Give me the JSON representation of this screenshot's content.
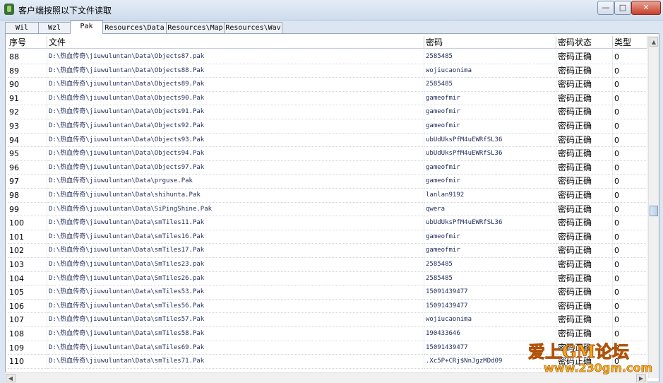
{
  "window": {
    "title": "客户端按照以下文件读取",
    "min": "—",
    "max": "□",
    "close": "✕"
  },
  "tabs": [
    "Wil",
    "Wzl",
    "Pak",
    "Resources\\Data",
    "Resources\\Map",
    "Resources\\Wav"
  ],
  "active_tab": "Pak",
  "columns": [
    "序号",
    "文件",
    "密码",
    "密码状态",
    "类型"
  ],
  "rows": [
    {
      "idx": "88",
      "file": "D:\\热血传奇\\jiuwuluntan\\Data\\Objects87.pak",
      "pwd": "2585485",
      "status": "密码正确",
      "type": "0"
    },
    {
      "idx": "89",
      "file": "D:\\热血传奇\\jiuwuluntan\\Data\\Objects88.Pak",
      "pwd": "wojiucaonima",
      "status": "密码正确",
      "type": "0"
    },
    {
      "idx": "90",
      "file": "D:\\热血传奇\\jiuwuluntan\\Data\\Objects89.Pak",
      "pwd": "2585485",
      "status": "密码正确",
      "type": "0"
    },
    {
      "idx": "91",
      "file": "D:\\热血传奇\\jiuwuluntan\\Data\\Objects90.Pak",
      "pwd": "gameofmir",
      "status": "密码正确",
      "type": "0"
    },
    {
      "idx": "92",
      "file": "D:\\热血传奇\\jiuwuluntan\\Data\\Objects91.Pak",
      "pwd": "gameofmir",
      "status": "密码正确",
      "type": "0"
    },
    {
      "idx": "93",
      "file": "D:\\热血传奇\\jiuwuluntan\\Data\\Objects92.Pak",
      "pwd": "gameofmir",
      "status": "密码正确",
      "type": "0"
    },
    {
      "idx": "94",
      "file": "D:\\热血传奇\\jiuwuluntan\\Data\\Objects93.Pak",
      "pwd": "ubUdUksPfM4uEWRfSL36",
      "status": "密码正确",
      "type": "0"
    },
    {
      "idx": "95",
      "file": "D:\\热血传奇\\jiuwuluntan\\Data\\Objects94.Pak",
      "pwd": "ubUdUksPfM4uEWRfSL36",
      "status": "密码正确",
      "type": "0"
    },
    {
      "idx": "96",
      "file": "D:\\热血传奇\\jiuwuluntan\\Data\\Objects97.Pak",
      "pwd": "gameofmir",
      "status": "密码正确",
      "type": "0"
    },
    {
      "idx": "97",
      "file": "D:\\热血传奇\\jiuwuluntan\\Data\\prguse.Pak",
      "pwd": "gameofmir",
      "status": "密码正确",
      "type": "0"
    },
    {
      "idx": "98",
      "file": "D:\\热血传奇\\jiuwuluntan\\Data\\shihunta.Pak",
      "pwd": "lanlan9192",
      "status": "密码正确",
      "type": "0"
    },
    {
      "idx": "99",
      "file": "D:\\热血传奇\\jiuwuluntan\\Data\\SiPingShine.Pak",
      "pwd": "qwera",
      "status": "密码正确",
      "type": "0"
    },
    {
      "idx": "100",
      "file": "D:\\热血传奇\\jiuwuluntan\\Data\\smTiles11.Pak",
      "pwd": "ubUdUksPfM4uEWRfSL36",
      "status": "密码正确",
      "type": "0"
    },
    {
      "idx": "101",
      "file": "D:\\热血传奇\\jiuwuluntan\\Data\\smTiles16.Pak",
      "pwd": "gameofmir",
      "status": "密码正确",
      "type": "0"
    },
    {
      "idx": "102",
      "file": "D:\\热血传奇\\jiuwuluntan\\Data\\smTiles17.Pak",
      "pwd": "gameofmir",
      "status": "密码正确",
      "type": "0"
    },
    {
      "idx": "103",
      "file": "D:\\热血传奇\\jiuwuluntan\\Data\\SmTiles23.pak",
      "pwd": "2585485",
      "status": "密码正确",
      "type": "0"
    },
    {
      "idx": "104",
      "file": "D:\\热血传奇\\jiuwuluntan\\Data\\SmTiles26.pak",
      "pwd": "2585485",
      "status": "密码正确",
      "type": "0"
    },
    {
      "idx": "105",
      "file": "D:\\热血传奇\\jiuwuluntan\\Data\\smTiles53.Pak",
      "pwd": "15091439477",
      "status": "密码正确",
      "type": "0"
    },
    {
      "idx": "106",
      "file": "D:\\热血传奇\\jiuwuluntan\\Data\\smTiles56.Pak",
      "pwd": "15091439477",
      "status": "密码正确",
      "type": "0"
    },
    {
      "idx": "107",
      "file": "D:\\热血传奇\\jiuwuluntan\\Data\\smTiles57.Pak",
      "pwd": "wojiucaonima",
      "status": "密码正确",
      "type": "0"
    },
    {
      "idx": "108",
      "file": "D:\\热血传奇\\jiuwuluntan\\Data\\smTiles58.Pak",
      "pwd": "190433646",
      "status": "密码正确",
      "type": "0"
    },
    {
      "idx": "109",
      "file": "D:\\热血传奇\\jiuwuluntan\\Data\\smTiles69.Pak",
      "pwd": "15091439477",
      "status": "密码正确",
      "type": "0"
    },
    {
      "idx": "110",
      "file": "D:\\热血传奇\\jiuwuluntan\\Data\\smTiles71.Pak",
      "pwd": ".Xc5P+CRj$NnJgzMDd09",
      "status": "密码正确",
      "type": "0"
    }
  ],
  "scrollbar": {
    "up": "▲",
    "down": "▼",
    "left": "◀",
    "right": "▶"
  },
  "watermark": {
    "line1": "爱上GM论坛",
    "line2": "www.230gm.com"
  }
}
